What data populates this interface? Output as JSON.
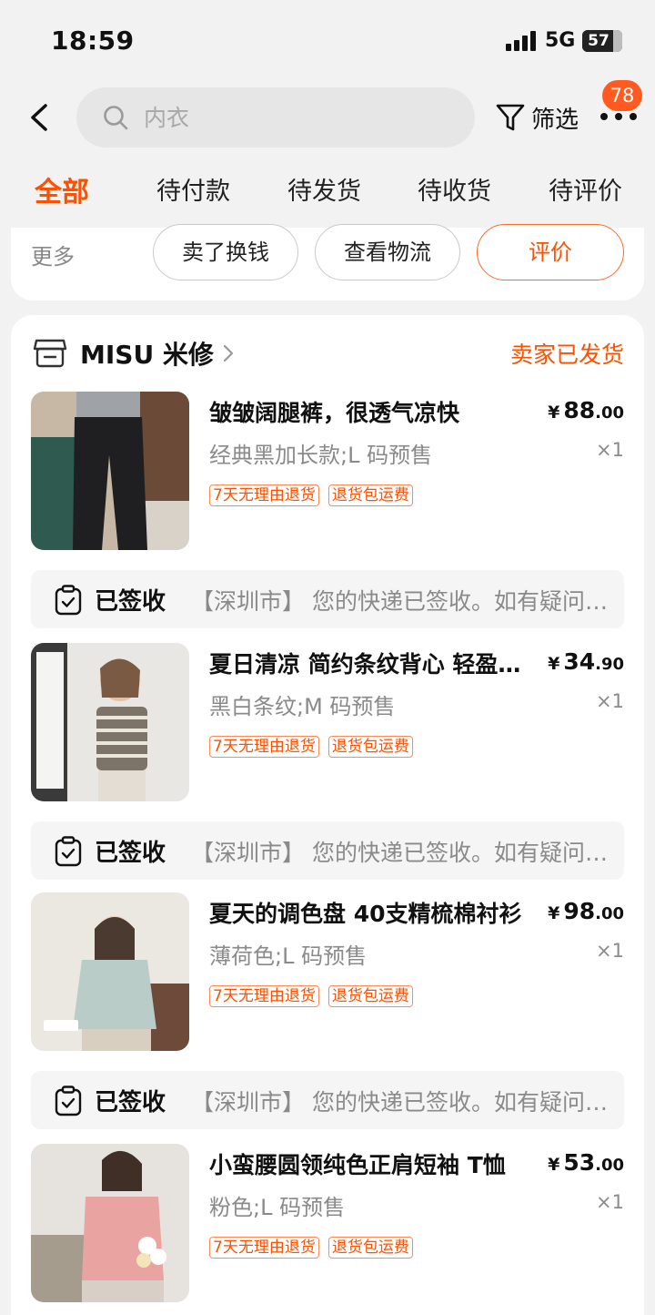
{
  "status_bar": {
    "time": "18:59",
    "network": "5G",
    "battery": "57"
  },
  "header": {
    "search_placeholder": "内衣",
    "filter_label": "筛选",
    "badge_count": "78"
  },
  "tabs": [
    {
      "label": "全部",
      "active": true
    },
    {
      "label": "待付款",
      "active": false
    },
    {
      "label": "待发货",
      "active": false
    },
    {
      "label": "待收货",
      "active": false
    },
    {
      "label": "待评价",
      "active": false
    }
  ],
  "prev_order": {
    "more_label": "更多",
    "actions": [
      "卖了换钱",
      "查看物流",
      "评价"
    ]
  },
  "order": {
    "shop_name": "MISU 米修",
    "status": "卖家已发货",
    "items": [
      {
        "title": "皱皱阔腿裤，很透气凉快",
        "spec": "经典黑加长款;L 码预售",
        "price_symbol": "¥",
        "price_int": "88",
        "price_dec": ".00",
        "qty": "×1",
        "tags": [
          "7天无理由退货",
          "退货包运费"
        ]
      },
      {
        "title": "夏日清凉 简约条纹背心 轻盈透气",
        "spec": "黑白条纹;M 码预售",
        "price_symbol": "¥",
        "price_int": "34",
        "price_dec": ".90",
        "qty": "×1",
        "tags": [
          "7天无理由退货",
          "退货包运费"
        ]
      },
      {
        "title": "夏天的调色盘 40支精梳棉衬衫",
        "spec": "薄荷色;L 码预售",
        "price_symbol": "¥",
        "price_int": "98",
        "price_dec": ".00",
        "qty": "×1",
        "tags": [
          "7天无理由退货",
          "退货包运费"
        ]
      },
      {
        "title": "小蛮腰圆领纯色正肩短袖 T恤",
        "spec": "粉色;L 码预售",
        "price_symbol": "¥",
        "price_int": "53",
        "price_dec": ".00",
        "qty": "×1",
        "tags": [
          "7天无理由退货",
          "退货包运费"
        ]
      }
    ],
    "logistics": [
      {
        "status": "已签收",
        "detail": "【深圳市】 您的快递已签收。如有疑问请联系快递员"
      },
      {
        "status": "已签收",
        "detail": "【深圳市】 您的快递已签收。如有疑问请联系快递员"
      },
      {
        "status": "已签收",
        "detail": "【深圳市】 您的快递已签收。如有疑问请联系快递员"
      }
    ]
  },
  "colors": {
    "accent": "#ff5000",
    "badge": "#ff5a1f",
    "background": "#f2f2f2"
  },
  "icons": [
    "back-arrow-icon",
    "search-icon",
    "filter-funnel-icon",
    "more-dots-icon",
    "shop-icon",
    "chevron-right-icon",
    "clipboard-check-icon"
  ]
}
